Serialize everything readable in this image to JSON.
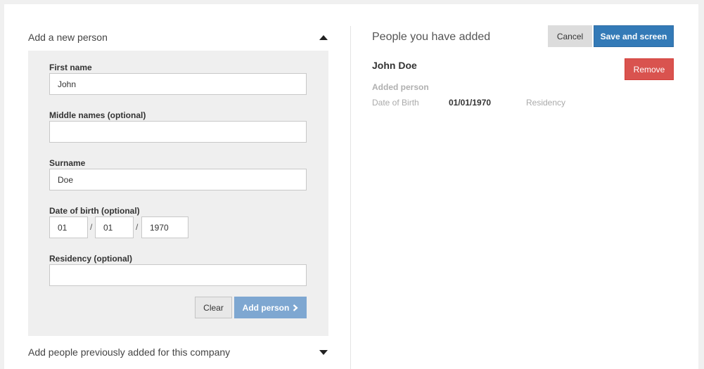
{
  "add_person": {
    "header": "Add a new person",
    "fields": {
      "first_name": {
        "label": "First name",
        "value": "John"
      },
      "middle_names": {
        "label": "Middle names (optional)",
        "value": ""
      },
      "surname": {
        "label": "Surname",
        "value": "Doe"
      },
      "date_of_birth": {
        "label": "Date of birth (optional)",
        "day": "01",
        "month": "01",
        "year": "1970",
        "separator": "/"
      },
      "residency": {
        "label": "Residency (optional)",
        "value": ""
      }
    },
    "clear_label": "Clear",
    "add_label": "Add person",
    "add_icon": "chevron-right-icon"
  },
  "previous": {
    "header": "Add people previously added for this company"
  },
  "people_added": {
    "title": "People you have added",
    "cancel_label": "Cancel",
    "save_label": "Save and screen",
    "person": {
      "name": "John Doe",
      "remove_label": "Remove",
      "status": "Added person",
      "dob_label": "Date of Birth",
      "dob_value": "01/01/1970",
      "residency_label": "Residency"
    }
  },
  "colors": {
    "primary": "#337ab7",
    "add_button": "#7ea7d1",
    "danger": "#d9534f",
    "form_bg": "#efefef"
  }
}
